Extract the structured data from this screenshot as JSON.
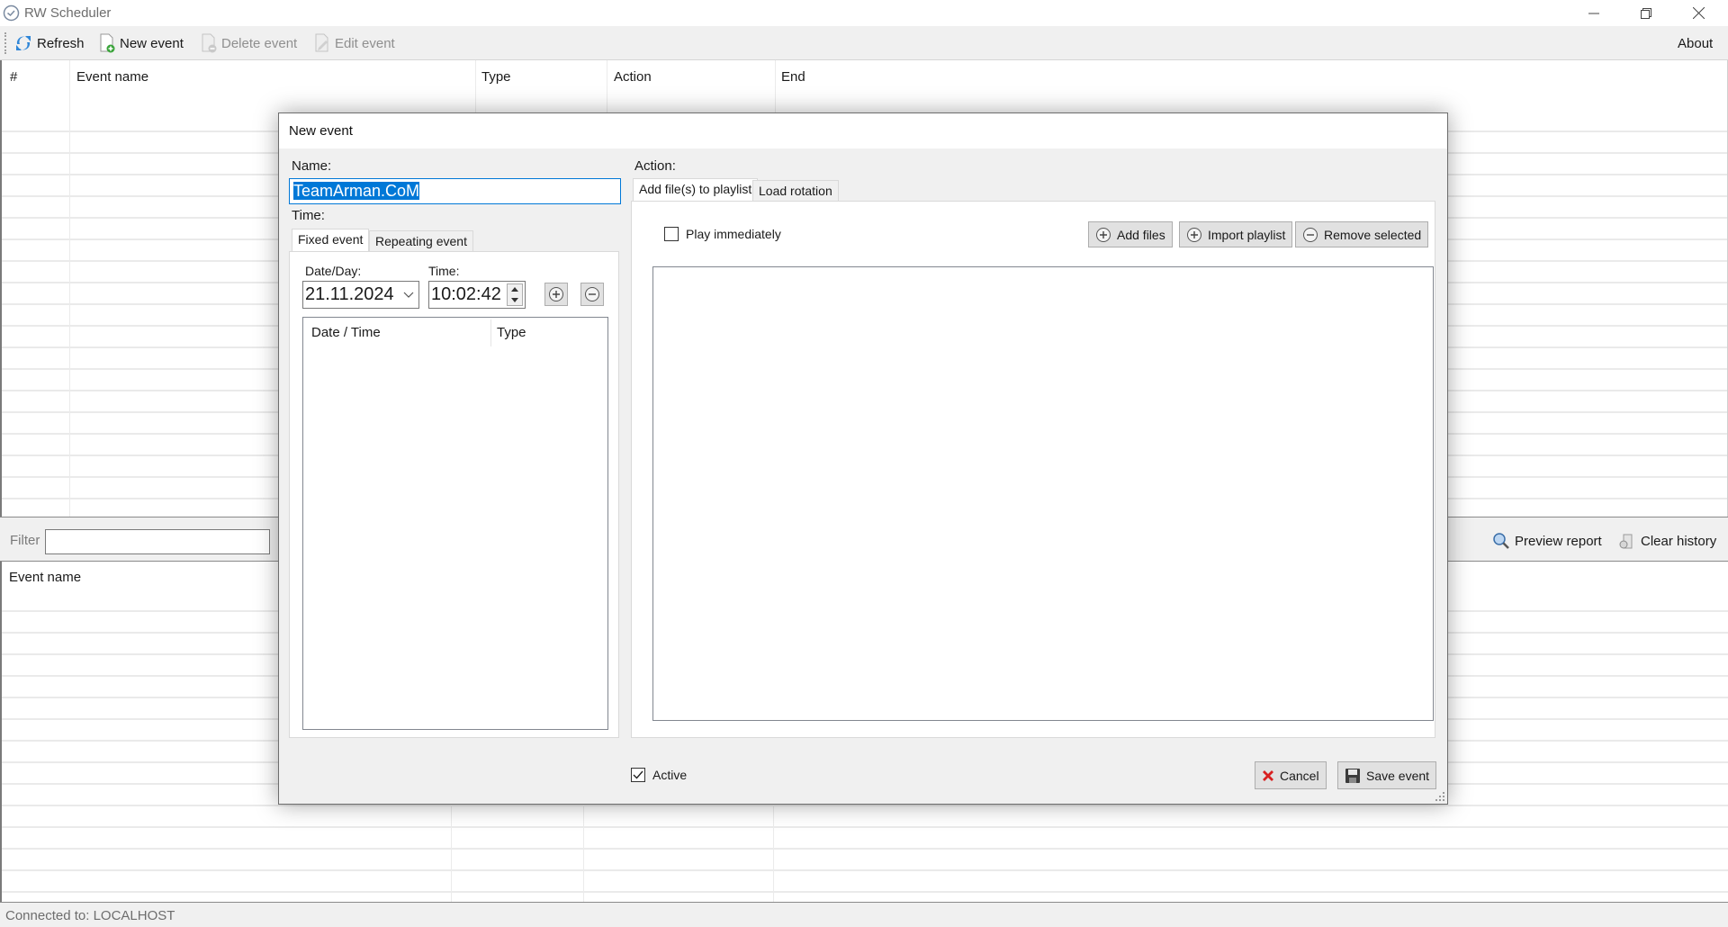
{
  "window": {
    "title": "RW Scheduler",
    "icon": "clock-icon",
    "controls": [
      "minimize-icon",
      "restore-icon",
      "close-icon"
    ]
  },
  "toolbar": {
    "refresh_label": "Refresh",
    "new_event_label": "New event",
    "delete_event_label": "Delete event",
    "edit_event_label": "Edit event",
    "about_label": "About"
  },
  "events_table": {
    "columns": [
      "#",
      "Event name",
      "Type",
      "Action",
      "End"
    ],
    "rows": []
  },
  "filter": {
    "label": "Filter",
    "value": "",
    "preview_report_label": "Preview report",
    "clear_history_label": "Clear history"
  },
  "history_table": {
    "columns": [
      "Event name"
    ],
    "rows": []
  },
  "status": {
    "text": "Connected to: LOCALHOST"
  },
  "dialog": {
    "title": "New event",
    "name_label": "Name:",
    "name_value": "TeamArman.CoM",
    "time_label": "Time:",
    "time_tabs": [
      {
        "label": "Fixed event",
        "active": true
      },
      {
        "label": "Repeating event",
        "active": false
      }
    ],
    "date_label": "Date/Day:",
    "date_value": "21.11.2024",
    "time_field_label": "Time:",
    "time_value": "10:02:42",
    "schedule_list": {
      "columns": [
        "Date / Time",
        "Type"
      ],
      "rows": []
    },
    "action_label": "Action:",
    "action_tabs": [
      {
        "label": "Add file(s) to playlist",
        "active": true
      },
      {
        "label": "Load rotation",
        "active": false
      }
    ],
    "play_immediately_label": "Play immediately",
    "play_immediately_checked": false,
    "add_files_label": "Add files",
    "import_playlist_label": "Import playlist",
    "remove_selected_label": "Remove selected",
    "files": [],
    "active_label": "Active",
    "active_checked": true,
    "cancel_label": "Cancel",
    "save_label": "Save event"
  }
}
